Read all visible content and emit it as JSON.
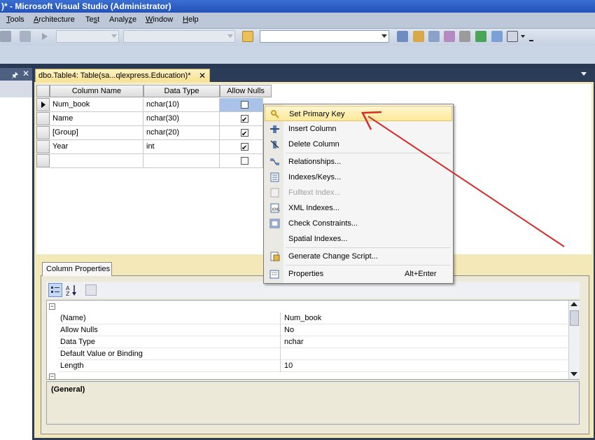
{
  "window": {
    "title": ")* - Microsoft Visual Studio (Administrator)"
  },
  "menubar": {
    "items": [
      {
        "label": "Tools",
        "accel": "T",
        "rest": "ools"
      },
      {
        "label": "Architecture",
        "accel": "A",
        "rest": "rchitecture"
      },
      {
        "label": "Test",
        "pre": "Te",
        "accel": "s",
        "rest": "t"
      },
      {
        "label": "Analyze",
        "pre": "Analy",
        "accel": "z",
        "rest": "e"
      },
      {
        "label": "Window",
        "accel": "W",
        "rest": "indow"
      },
      {
        "label": "Help",
        "accel": "H",
        "rest": "elp"
      }
    ]
  },
  "toolbar": {
    "config_combo": "",
    "platform_combo": "",
    "find_combo": ""
  },
  "left_panel": {
    "pin_icon": "pin-icon",
    "close_icon": "close-icon"
  },
  "document": {
    "tab_label": "dbo.Table4: Table(sa...qlexpress.Education)*",
    "close_glyph": "✕"
  },
  "grid": {
    "headers": [
      "Column Name",
      "Data Type",
      "Allow Nulls"
    ],
    "rows": [
      {
        "name": "Num_book",
        "type": "nchar(10)",
        "nulls": false,
        "current": true
      },
      {
        "name": "Name",
        "type": "nchar(30)",
        "nulls": true
      },
      {
        "name": "[Group]",
        "type": "nchar(20)",
        "nulls": true
      },
      {
        "name": "Year",
        "type": "int",
        "nulls": true
      },
      {
        "name": "",
        "type": "",
        "nulls": false
      }
    ]
  },
  "context_menu": {
    "items": [
      {
        "label": "Set Primary Key",
        "icon": "key-icon",
        "highlighted": true
      },
      {
        "label": "Insert Column",
        "icon": "insert-column-icon"
      },
      {
        "label": "Delete Column",
        "icon": "delete-column-icon"
      },
      {
        "separator": true
      },
      {
        "label": "Relationships...",
        "icon": "relationships-icon"
      },
      {
        "label": "Indexes/Keys...",
        "icon": "indexes-keys-icon"
      },
      {
        "label": "Fulltext Index...",
        "icon": "fulltext-index-icon",
        "disabled": true
      },
      {
        "label": "XML Indexes...",
        "icon": "xml-indexes-icon"
      },
      {
        "label": "Check Constraints...",
        "icon": "check-constraints-icon"
      },
      {
        "label": "Spatial Indexes...",
        "icon": ""
      },
      {
        "separator": true
      },
      {
        "label": "Generate Change Script...",
        "icon": "generate-script-icon"
      },
      {
        "separator": true
      },
      {
        "label": "Properties",
        "icon": "properties-icon",
        "shortcut": "Alt+Enter"
      }
    ]
  },
  "column_properties": {
    "tab_label": "Column Properties",
    "group_expander": "⊟",
    "rows": [
      {
        "name": "(Name)",
        "value": "Num_book"
      },
      {
        "name": "Allow Nulls",
        "value": "No"
      },
      {
        "name": "Data Type",
        "value": "nchar"
      },
      {
        "name": "Default Value or Binding",
        "value": ""
      },
      {
        "name": "Length",
        "value": "10"
      }
    ],
    "description": "(General)"
  },
  "colors": {
    "accent_arrow": "#d42b2b",
    "highlight": "#fde99a",
    "vs_chrome": "#293955"
  }
}
